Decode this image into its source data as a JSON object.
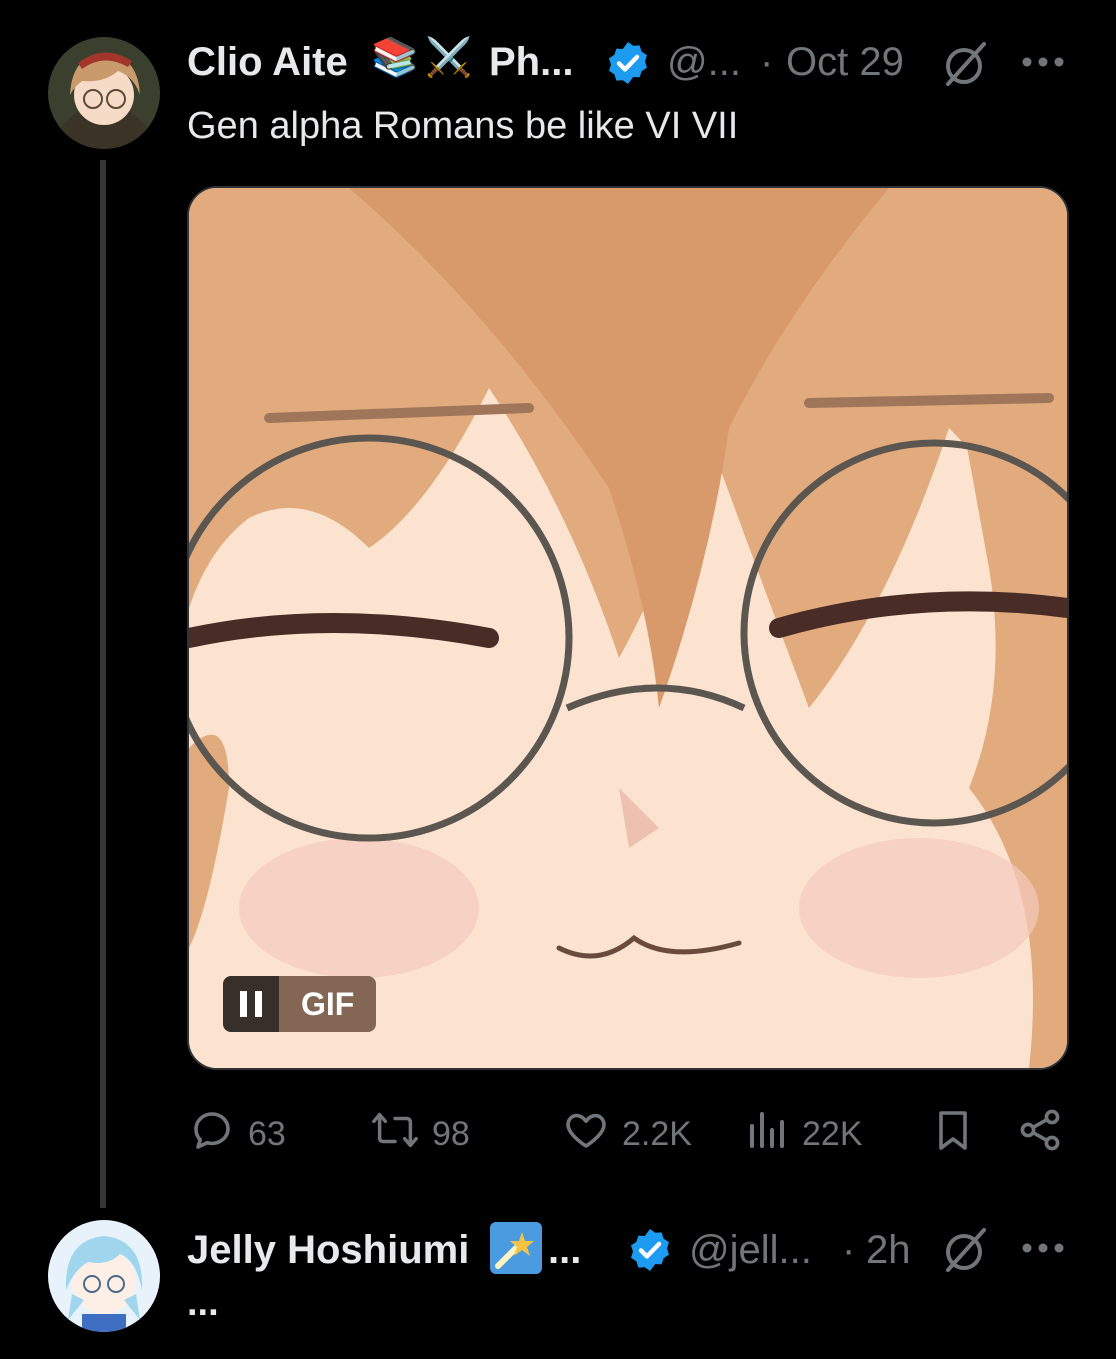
{
  "tweet1": {
    "display_name": "Clio Aite",
    "name_suffix": "Ph...",
    "handle": "@...",
    "separator": "·",
    "time": "Oct 29",
    "text": "Gen alpha Romans be like VI VII",
    "media": {
      "badge_label": "GIF",
      "pause_symbol": "II"
    },
    "stats": {
      "replies": "63",
      "reposts": "98",
      "likes": "2.2K",
      "views": "22K"
    }
  },
  "tweet2": {
    "display_name": "Jelly Hoshiumi",
    "name_ellipsis": "...",
    "handle": "@jell...",
    "separator": "·",
    "time": "2h",
    "text": "..."
  },
  "icons": {
    "verified": "verified-badge-icon",
    "grok": "grok-slash-icon",
    "more": "more-dots-icon",
    "reply": "reply-bubble-icon",
    "repost": "repost-arrows-icon",
    "like": "heart-icon",
    "views": "views-bars-icon",
    "bookmark": "bookmark-icon",
    "share": "share-icon"
  },
  "colors": {
    "background": "#000000",
    "text": "#e7e9ea",
    "muted": "#71767b",
    "verified": "#1d9bf0",
    "divider": "#333639"
  }
}
